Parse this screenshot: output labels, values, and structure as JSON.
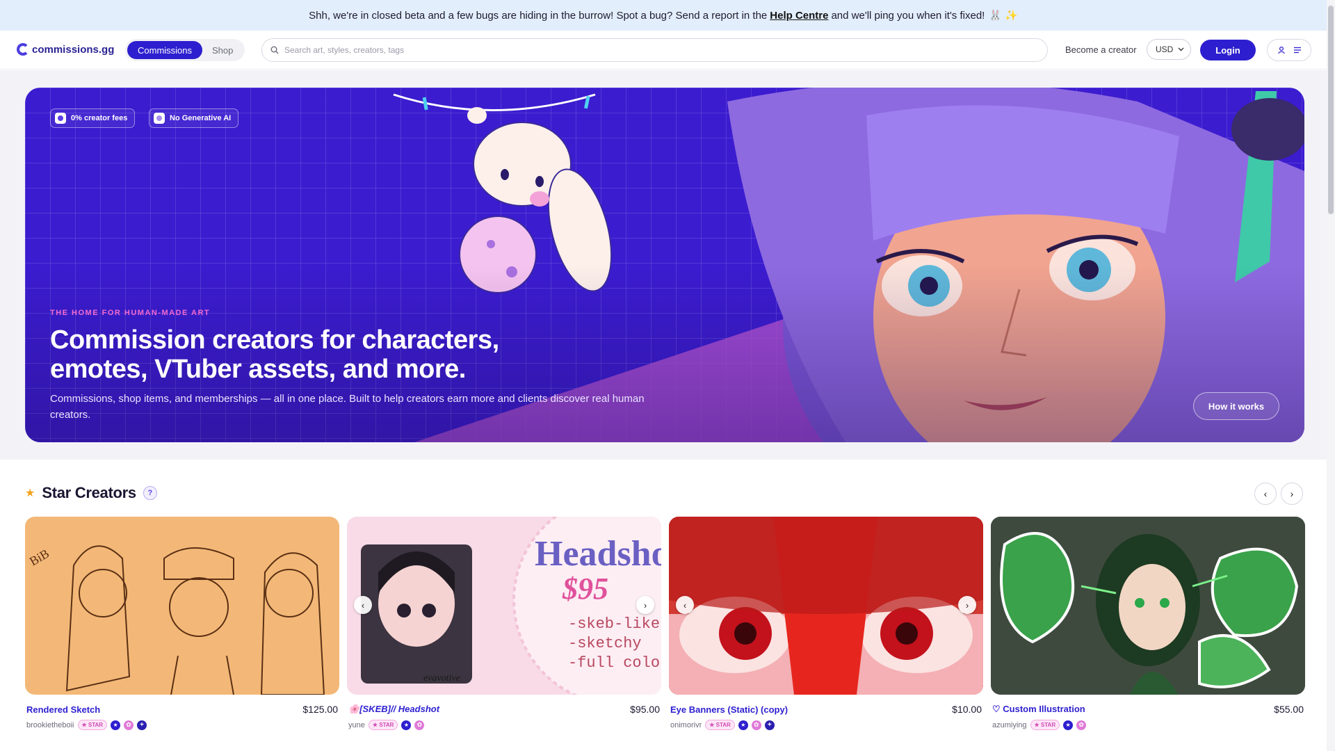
{
  "banner": {
    "before_link": "Shh, we're in closed beta and a few bugs are hiding in the burrow! Spot a bug? Send a report in the",
    "link": "Help Centre",
    "after_link": "and we'll ping you when it's fixed!",
    "emoji": "🐰 ✨"
  },
  "header": {
    "logo_text": "commissions.gg",
    "tabs": [
      {
        "label": "Commissions",
        "active": true
      },
      {
        "label": "Shop",
        "active": false
      }
    ],
    "search_placeholder": "Search art, styles, creators, tags",
    "become_creator": "Become a creator",
    "currency": "USD",
    "login": "Login",
    "icons": [
      "search-icon",
      "chevron-down-icon",
      "user-icon",
      "menu-icon"
    ]
  },
  "hero": {
    "badges": [
      "0% creator fees",
      "No Generative AI"
    ],
    "eyebrow": "THE HOME FOR HUMAN-MADE ART",
    "headline_line1": "Commission creators for characters,",
    "headline_line2": "emotes, VTuber assets, and more.",
    "subtext": "Commissions, shop items, and memberships — all in one place. Built to help creators earn more and clients discover real human creators.",
    "cta": "How it works",
    "colors": {
      "background": "#3b1ccf",
      "accent": "#f26bd0"
    }
  },
  "star_creators": {
    "title": "Star Creators",
    "help": "?",
    "prev": "‹",
    "next": "›",
    "cards": [
      {
        "title": "Rendered Sketch",
        "price": "$125.00",
        "creator": "brookietheboii",
        "badge": "★ STAR",
        "thumb_text": ""
      },
      {
        "title": "🌸[SKEB]// Headshot",
        "price": "$95.00",
        "creator": "yune",
        "badge": "★ STAR",
        "thumb_text": "Headshot",
        "thumb_price": "$95",
        "thumb_lines": [
          "-skeb-like",
          "-sketchy",
          "-full color"
        ],
        "thumb_signature": "evavotive"
      },
      {
        "title": "Eye Banners (Static) (copy)",
        "price": "$10.00",
        "creator": "onimorivr",
        "badge": "★ STAR",
        "thumb_text": ""
      },
      {
        "title": "♡ Custom Illustration",
        "price": "$55.00",
        "creator": "azumiying",
        "badge": "★ STAR",
        "thumb_text": ""
      }
    ]
  }
}
